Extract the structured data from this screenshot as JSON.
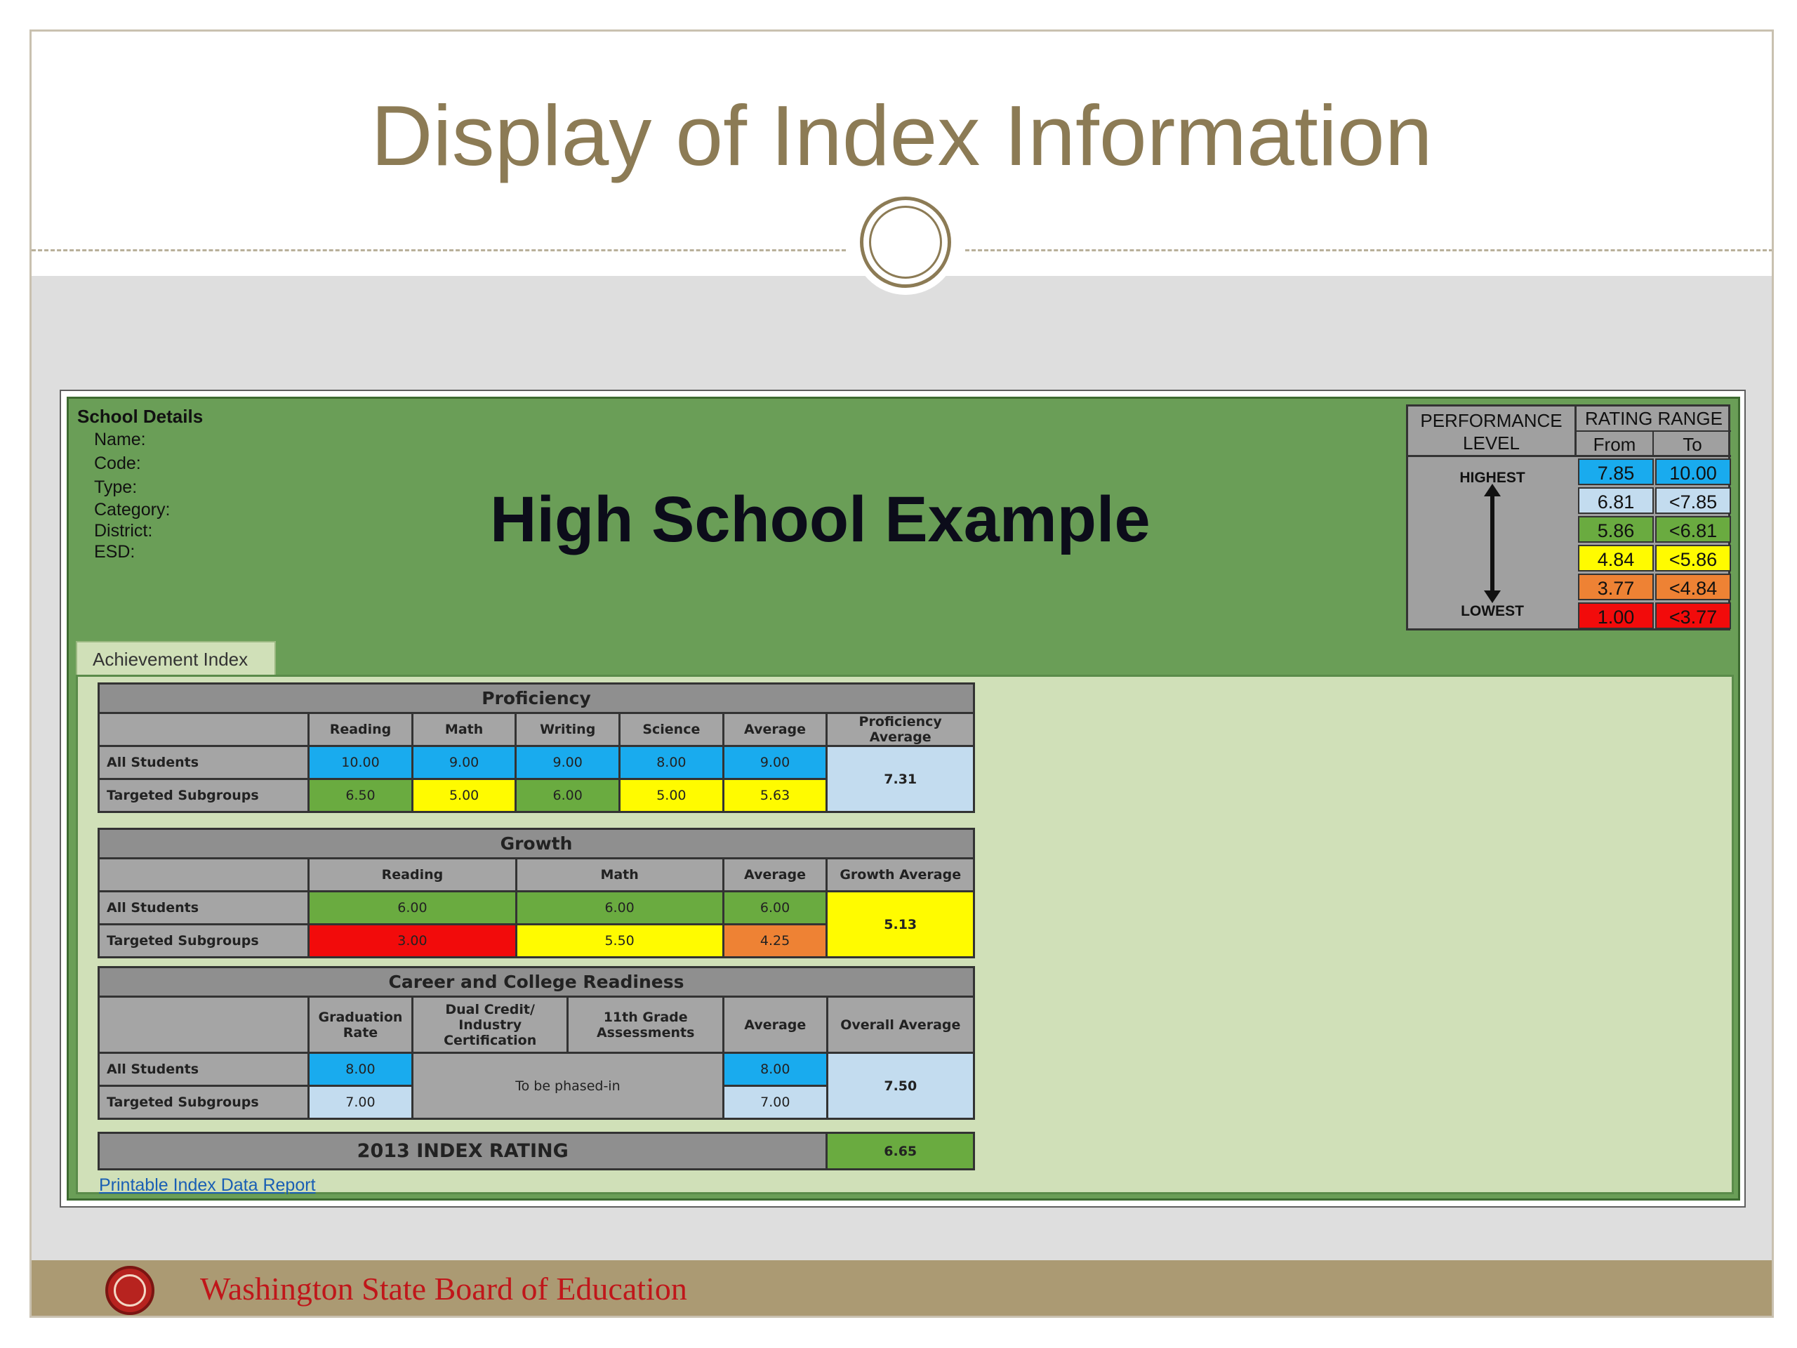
{
  "slide": {
    "title": "Display of Index Information",
    "footer_text": "Washington State Board of Education"
  },
  "school": {
    "details_heading": "School Details",
    "fields": [
      "Name:",
      "Code:",
      "Type:",
      "Category:",
      "District:",
      "ESD:"
    ],
    "name": "High School Example"
  },
  "legend": {
    "col1": "PERFORMANCE LEVEL",
    "col2": "RATING RANGE",
    "from": "From",
    "to": "To",
    "highest": "HIGHEST",
    "lowest": "LOWEST",
    "rows": [
      {
        "from": "7.85",
        "to": "10.00",
        "color": "#19abee"
      },
      {
        "from": "6.81",
        "to": "<7.85",
        "color": "#c3dcef"
      },
      {
        "from": "5.86",
        "to": "<6.81",
        "color": "#6aab40"
      },
      {
        "from": "4.84",
        "to": "<5.86",
        "color": "#fffb00"
      },
      {
        "from": "3.77",
        "to": "<4.84",
        "color": "#ee8234"
      },
      {
        "from": "1.00",
        "to": "<3.77",
        "color": "#f20b0b"
      }
    ]
  },
  "tab": {
    "label": "Achievement Index"
  },
  "proficiency": {
    "title": "Proficiency",
    "columns": [
      "Reading",
      "Math",
      "Writing",
      "Science",
      "Average",
      "Proficiency Average"
    ],
    "rows": [
      {
        "label": "All Students",
        "values": [
          "10.00",
          "9.00",
          "9.00",
          "8.00",
          "9.00"
        ]
      },
      {
        "label": "Targeted Subgroups",
        "values": [
          "6.50",
          "5.00",
          "6.00",
          "5.00",
          "5.63"
        ]
      }
    ],
    "overall": "7.31"
  },
  "growth": {
    "title": "Growth",
    "columns": [
      "Reading",
      "Math",
      "Average",
      "Growth Average"
    ],
    "rows": [
      {
        "label": "All Students",
        "values": [
          "6.00",
          "6.00",
          "6.00"
        ]
      },
      {
        "label": "Targeted Subgroups",
        "values": [
          "3.00",
          "5.50",
          "4.25"
        ]
      }
    ],
    "overall": "5.13"
  },
  "ccr": {
    "title": "Career and College Readiness",
    "columns": [
      "Graduation Rate",
      "Dual Credit/ Industry Certification",
      "11th Grade Assessments",
      "Average",
      "Overall Average"
    ],
    "rows": [
      {
        "label": "All Students",
        "grad": "8.00",
        "avg": "8.00"
      },
      {
        "label": "Targeted Subgroups",
        "grad": "7.00",
        "avg": "7.00"
      }
    ],
    "phased": "To be phased-in",
    "overall": "7.50"
  },
  "rating": {
    "label": "2013 INDEX RATING",
    "value": "6.65"
  },
  "link": {
    "label": "Printable Index Data Report"
  }
}
